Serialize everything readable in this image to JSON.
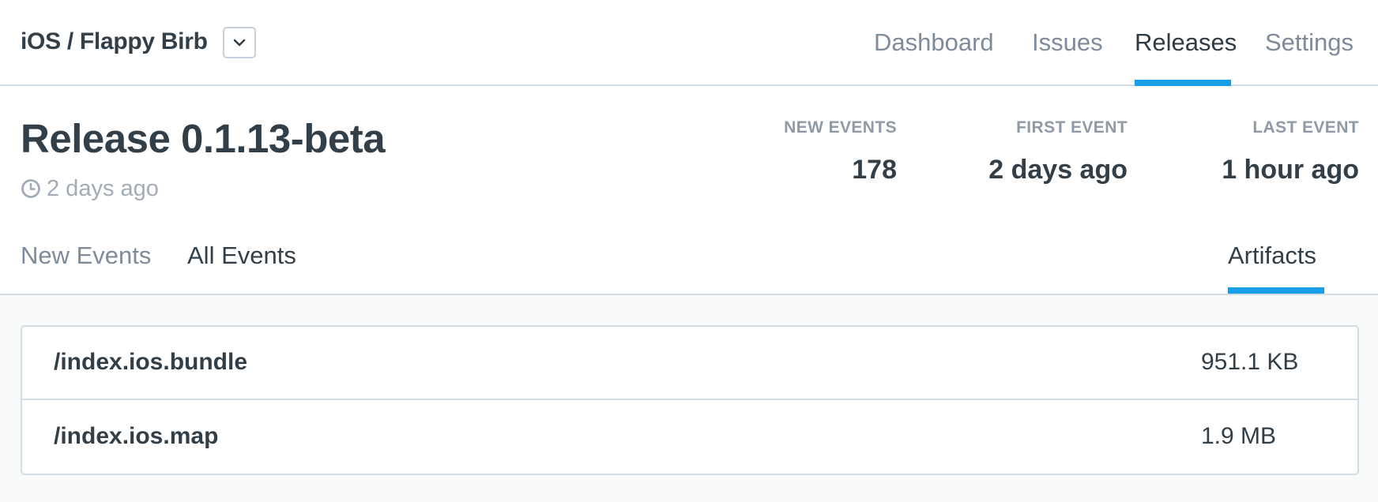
{
  "header": {
    "project": "iOS / Flappy Birb",
    "nav": [
      {
        "label": "Dashboard",
        "active": false
      },
      {
        "label": "Issues",
        "active": false
      },
      {
        "label": "Releases",
        "active": true
      },
      {
        "label": "Settings",
        "active": false
      }
    ],
    "dropdown_icon": "chevron-down-icon"
  },
  "release": {
    "title": "Release 0.1.13-beta",
    "age": "2 days ago",
    "age_icon": "clock-icon",
    "stats": [
      {
        "label": "NEW EVENTS",
        "value": "178"
      },
      {
        "label": "FIRST EVENT",
        "value": "2 days ago"
      },
      {
        "label": "LAST EVENT",
        "value": "1 hour ago"
      }
    ]
  },
  "tabs": [
    {
      "label": "New Events",
      "active": false
    },
    {
      "label": "All Events",
      "active": false
    },
    {
      "label": "Artifacts",
      "active": true
    }
  ],
  "artifacts": [
    {
      "name": "/index.ios.bundle",
      "size": "951.1 KB"
    },
    {
      "name": "/index.ios.map",
      "size": "1.9 MB"
    }
  ],
  "colors": {
    "accent": "#1a9ee8",
    "text": "#333f48",
    "muted": "#7e8b9a",
    "border": "#d3dde5"
  }
}
